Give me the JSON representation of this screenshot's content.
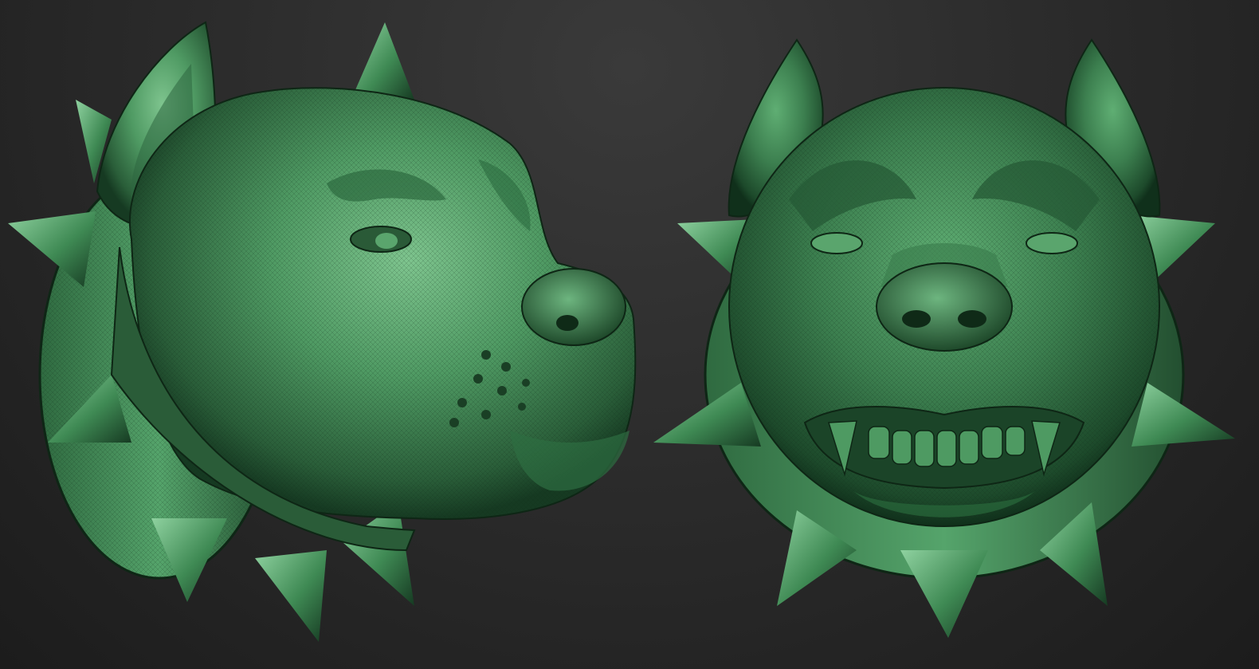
{
  "scene": {
    "background_color": "#2c2c2c",
    "material_color": "#4f9a63",
    "material_shadow": "#163a22",
    "material_highlight": "#8fd2a0"
  },
  "models": [
    {
      "name": "side-view",
      "subject": "spiked-collar-dog-head"
    },
    {
      "name": "front-view",
      "subject": "spiked-collar-dog-head"
    }
  ]
}
